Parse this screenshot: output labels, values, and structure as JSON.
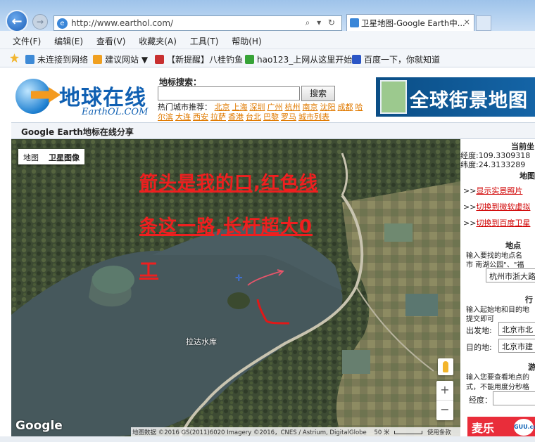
{
  "browser": {
    "url": "http://www.earthol.com/",
    "tab_title": "卫星地图-Google Earth中...",
    "tab_close": "×",
    "back_glyph": "←",
    "fwd_glyph": "→",
    "addr_tools": "⌕ ▾ ↻"
  },
  "menu": [
    "文件(F)",
    "编辑(E)",
    "查看(V)",
    "收藏夹(A)",
    "工具(T)",
    "帮助(H)"
  ],
  "favorites": [
    {
      "label": "未连接到网络",
      "color": "#3e8ad6"
    },
    {
      "label": "建议网站 ▼",
      "color": "#f0a020"
    },
    {
      "label": "【新提醒】八桂钓鱼",
      "color": "#c83030"
    },
    {
      "label": "hao123_上网从这里开始",
      "color": "#37a337"
    },
    {
      "label": "百度一下，你就知道",
      "color": "#2b56c6"
    }
  ],
  "header": {
    "logo_cn": "地球在线",
    "logo_en": "EarthOL.COM",
    "search_label": "地标搜索：",
    "search_button": "搜索",
    "hot_label": "热门城市推荐：",
    "hot_cities_row1": [
      "北京",
      "上海",
      "深圳",
      "广州",
      "杭州",
      "南京",
      "沈阳",
      "成都",
      "哈"
    ],
    "hot_cities_row2": [
      "尔滨",
      "大连",
      "西安",
      "拉萨",
      "香港",
      "台北",
      "巴黎",
      "罗马",
      "城市列表"
    ],
    "banner_text": "全球街景地图"
  },
  "page_title": "Google Earth地标在线分享",
  "map": {
    "type_map": "地图",
    "type_satellite": "卫星图像",
    "note_line1": "箭头是我的口,红色线",
    "note_line2": "条这一路,长杆超大0",
    "note_line3": "工",
    "lake_label": "拉达水库",
    "google": "Google",
    "attribution": "地图数据 ©2016 GS(2011)6020 Imagery ©2016，CNES / Astrium, DigitalGlobe",
    "scale": "50 米",
    "terms": "使用条款",
    "zoom_in": "+",
    "zoom_out": "−"
  },
  "panel": {
    "coord_title": "当前坐",
    "lng": "经度:109.3309318",
    "lat": "纬度:24.3133289",
    "map_title": "地图",
    "link1": "显示实景照片",
    "link2": "切换到微软虚拟",
    "link3": "切换到百度卫星",
    "place_title": "地点",
    "place_desc1": "输入要找的地点名",
    "place_desc2": "市 南湖公园\"、\"福",
    "place_value": "杭州市浙大路",
    "route_title": "行",
    "route_desc1": "输入起始地和目的地",
    "route_desc2": "提交即可",
    "from_label": "出发地:",
    "from_value": "北京市北",
    "to_label": "目的地:",
    "to_value": "北京市建",
    "tour_title": "游",
    "tour_desc1": "输入您要查看地点的",
    "tour_desc2": "式，不能用度分秒格",
    "lng_label": "经度：",
    "ad_text": "麦乐",
    "ad_logo": "GUU.com"
  }
}
